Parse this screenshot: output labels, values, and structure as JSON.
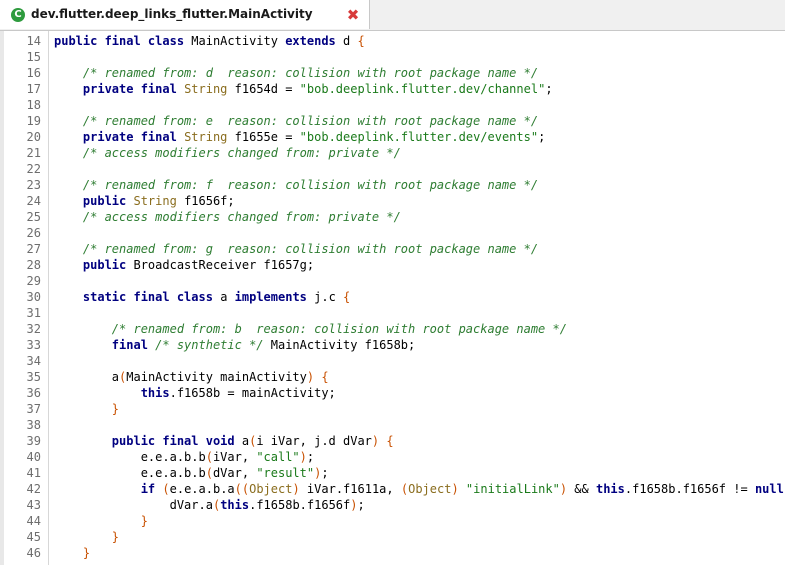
{
  "tab": {
    "title": "dev.flutter.deep_links_flutter.MainActivity",
    "icon": "class-icon",
    "icon_glyph": "C",
    "close_glyph": "✖"
  },
  "colors": {
    "keyword": "#000080",
    "comment": "#2e7d32",
    "string": "#1a7a1a",
    "type": "#8a6d1e",
    "close": "#d83a3a"
  },
  "code_lines": [
    {
      "n": "14",
      "t": [
        [
          "kw",
          "public final class "
        ],
        [
          "",
          "MainActivity "
        ],
        [
          "kw",
          "extends "
        ],
        [
          "",
          "d "
        ],
        [
          "pn",
          "{"
        ]
      ]
    },
    {
      "n": "15",
      "t": []
    },
    {
      "n": "16",
      "t": [
        [
          "",
          "    "
        ],
        [
          "cm",
          "/* renamed from: d  reason: collision with root package name */"
        ]
      ]
    },
    {
      "n": "17",
      "t": [
        [
          "",
          "    "
        ],
        [
          "kw",
          "private final "
        ],
        [
          "ty",
          "String "
        ],
        [
          "",
          "f1654d = "
        ],
        [
          "st",
          "\"bob.deeplink.flutter.dev/channel\""
        ],
        [
          "",
          ";"
        ]
      ]
    },
    {
      "n": "18",
      "t": []
    },
    {
      "n": "19",
      "t": [
        [
          "",
          "    "
        ],
        [
          "cm",
          "/* renamed from: e  reason: collision with root package name */"
        ]
      ]
    },
    {
      "n": "20",
      "t": [
        [
          "",
          "    "
        ],
        [
          "kw",
          "private final "
        ],
        [
          "ty",
          "String "
        ],
        [
          "",
          "f1655e = "
        ],
        [
          "st",
          "\"bob.deeplink.flutter.dev/events\""
        ],
        [
          "",
          ";"
        ]
      ]
    },
    {
      "n": "21",
      "t": [
        [
          "",
          "    "
        ],
        [
          "cm",
          "/* access modifiers changed from: private */"
        ]
      ]
    },
    {
      "n": "22",
      "t": []
    },
    {
      "n": "23",
      "t": [
        [
          "",
          "    "
        ],
        [
          "cm",
          "/* renamed from: f  reason: collision with root package name */"
        ]
      ]
    },
    {
      "n": "24",
      "t": [
        [
          "",
          "    "
        ],
        [
          "kw",
          "public "
        ],
        [
          "ty",
          "String "
        ],
        [
          "",
          "f1656f;"
        ]
      ]
    },
    {
      "n": "25",
      "t": [
        [
          "",
          "    "
        ],
        [
          "cm",
          "/* access modifiers changed from: private */"
        ]
      ]
    },
    {
      "n": "26",
      "t": []
    },
    {
      "n": "27",
      "t": [
        [
          "",
          "    "
        ],
        [
          "cm",
          "/* renamed from: g  reason: collision with root package name */"
        ]
      ]
    },
    {
      "n": "28",
      "t": [
        [
          "",
          "    "
        ],
        [
          "kw",
          "public "
        ],
        [
          "",
          "BroadcastReceiver f1657g;"
        ]
      ]
    },
    {
      "n": "29",
      "t": []
    },
    {
      "n": "30",
      "t": [
        [
          "",
          "    "
        ],
        [
          "kw",
          "static final class "
        ],
        [
          "",
          "a "
        ],
        [
          "kw",
          "implements "
        ],
        [
          "",
          "j.c "
        ],
        [
          "pn",
          "{"
        ]
      ]
    },
    {
      "n": "31",
      "t": []
    },
    {
      "n": "32",
      "t": [
        [
          "",
          "        "
        ],
        [
          "cm",
          "/* renamed from: b  reason: collision with root package name */"
        ]
      ]
    },
    {
      "n": "33",
      "t": [
        [
          "",
          "        "
        ],
        [
          "kw",
          "final "
        ],
        [
          "cm",
          "/* synthetic */ "
        ],
        [
          "",
          "MainActivity f1658b;"
        ]
      ]
    },
    {
      "n": "34",
      "t": []
    },
    {
      "n": "35",
      "t": [
        [
          "",
          "        a"
        ],
        [
          "pn",
          "("
        ],
        [
          "",
          "MainActivity mainActivity"
        ],
        [
          "pn",
          ")"
        ],
        [
          "",
          " "
        ],
        [
          "pn",
          "{"
        ]
      ]
    },
    {
      "n": "36",
      "t": [
        [
          "",
          "            "
        ],
        [
          "kw",
          "this"
        ],
        [
          "",
          ".f1658b = mainActivity;"
        ]
      ]
    },
    {
      "n": "37",
      "t": [
        [
          "",
          "        "
        ],
        [
          "pn",
          "}"
        ]
      ]
    },
    {
      "n": "38",
      "t": []
    },
    {
      "n": "39",
      "t": [
        [
          "",
          "        "
        ],
        [
          "kw",
          "public final void "
        ],
        [
          "",
          "a"
        ],
        [
          "pn",
          "("
        ],
        [
          "",
          "i iVar, j.d dVar"
        ],
        [
          "pn",
          ")"
        ],
        [
          "",
          " "
        ],
        [
          "pn",
          "{"
        ]
      ]
    },
    {
      "n": "40",
      "t": [
        [
          "",
          "            e.e.a.b.b"
        ],
        [
          "pn",
          "("
        ],
        [
          "",
          "iVar, "
        ],
        [
          "st",
          "\"call\""
        ],
        [
          "pn",
          ")"
        ],
        [
          "",
          ";"
        ]
      ]
    },
    {
      "n": "41",
      "t": [
        [
          "",
          "            e.e.a.b.b"
        ],
        [
          "pn",
          "("
        ],
        [
          "",
          "dVar, "
        ],
        [
          "st",
          "\"result\""
        ],
        [
          "pn",
          ")"
        ],
        [
          "",
          ";"
        ]
      ]
    },
    {
      "n": "42",
      "t": [
        [
          "",
          "            "
        ],
        [
          "kw",
          "if "
        ],
        [
          "pn",
          "("
        ],
        [
          "",
          "e.e.a.b.a"
        ],
        [
          "pn",
          "(("
        ],
        [
          "ty",
          "Object"
        ],
        [
          "pn",
          ")"
        ],
        [
          "",
          " iVar.f1611a, "
        ],
        [
          "pn",
          "("
        ],
        [
          "ty",
          "Object"
        ],
        [
          "pn",
          ")"
        ],
        [
          "",
          " "
        ],
        [
          "st",
          "\"initialLink\""
        ],
        [
          "pn",
          ")"
        ],
        [
          "",
          " && "
        ],
        [
          "kw",
          "this"
        ],
        [
          "",
          ".f1658b.f1656f != "
        ],
        [
          "kw",
          "null"
        ],
        [
          "pn",
          ")"
        ],
        [
          "",
          " "
        ],
        [
          "pn",
          "{"
        ]
      ]
    },
    {
      "n": "43",
      "t": [
        [
          "",
          "                dVar.a"
        ],
        [
          "pn",
          "("
        ],
        [
          "kw",
          "this"
        ],
        [
          "",
          ".f1658b.f1656f"
        ],
        [
          "pn",
          ")"
        ],
        [
          "",
          ";"
        ]
      ]
    },
    {
      "n": "44",
      "t": [
        [
          "",
          "            "
        ],
        [
          "pn",
          "}"
        ]
      ]
    },
    {
      "n": "45",
      "t": [
        [
          "",
          "        "
        ],
        [
          "pn",
          "}"
        ]
      ]
    },
    {
      "n": "46",
      "t": [
        [
          "",
          "    "
        ],
        [
          "pn",
          "}"
        ]
      ]
    }
  ]
}
